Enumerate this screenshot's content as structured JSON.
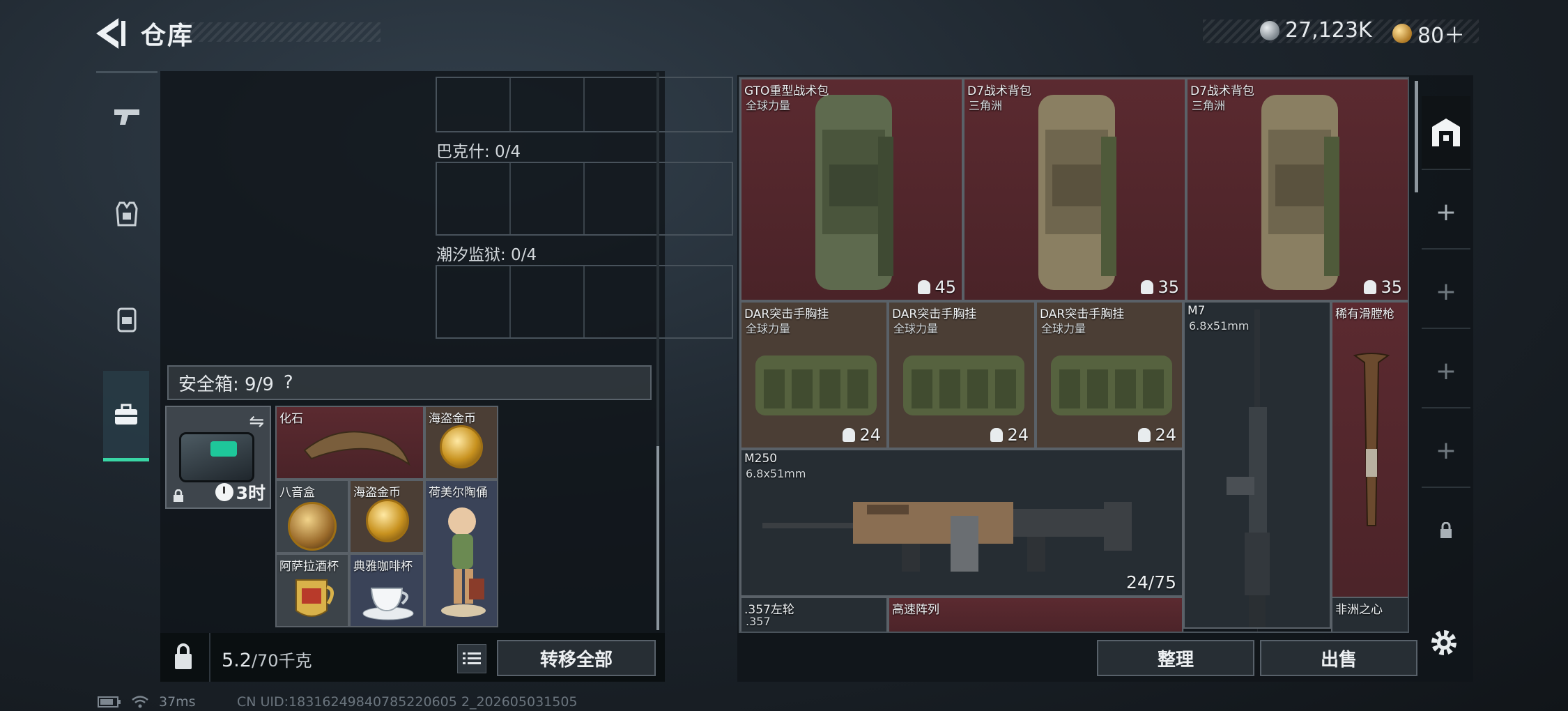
{
  "header": {
    "title": "仓库",
    "currency_silver": "27,123K",
    "currency_gold": "80＋"
  },
  "tabs": [
    {
      "name": "weapons",
      "icon": "pistol-icon"
    },
    {
      "name": "equipment",
      "icon": "vest-icon"
    },
    {
      "name": "backpack",
      "icon": "backpack-icon"
    },
    {
      "name": "safebox",
      "icon": "briefcase-icon",
      "active": true
    }
  ],
  "left": {
    "slots": [
      {
        "label": "巴克什: 0/4"
      },
      {
        "label": "潮汐监狱: 0/4"
      }
    ],
    "safebox_label": "安全箱: 9/9",
    "safebox_help": "?",
    "case_timer": "3时",
    "items": [
      {
        "name": "化石"
      },
      {
        "name": "海盗金币"
      },
      {
        "name": "八音盒"
      },
      {
        "name": "海盗金币"
      },
      {
        "name": "荷美尔陶俑"
      },
      {
        "name": "阿萨拉酒杯"
      },
      {
        "name": "典雅咖啡杯"
      }
    ],
    "weight_value": "5.2",
    "weight_max": "/70千克",
    "transfer_all": "转移全部"
  },
  "stash": {
    "items": [
      {
        "name": "GTO重型战术包",
        "sub": "全球力量",
        "cap": "45"
      },
      {
        "name": "D7战术背包",
        "sub": "三角洲",
        "cap": "35"
      },
      {
        "name": "D7战术背包",
        "sub": "三角洲",
        "cap": "35"
      },
      {
        "name": "DAR突击手胸挂",
        "sub": "全球力量",
        "cap": "24"
      },
      {
        "name": "DAR突击手胸挂",
        "sub": "全球力量",
        "cap": "24"
      },
      {
        "name": "DAR突击手胸挂",
        "sub": "全球力量",
        "cap": "24"
      },
      {
        "name": "M7",
        "sub": "6.8x51mm"
      },
      {
        "name": "稀有滑膛枪"
      },
      {
        "name": "M250",
        "sub": "6.8x51mm",
        "ammo": "24/75"
      },
      {
        "name": ".357左轮",
        "sub": ".357"
      },
      {
        "name": "高速阵列"
      },
      {
        "name": "非洲之心"
      }
    ],
    "sort_label": "整理",
    "sell_label": "出售"
  },
  "rail": {
    "add": "+"
  },
  "status": {
    "ping": "37ms",
    "uid": "CN UID:18316249840785220605 2_202605031505"
  }
}
